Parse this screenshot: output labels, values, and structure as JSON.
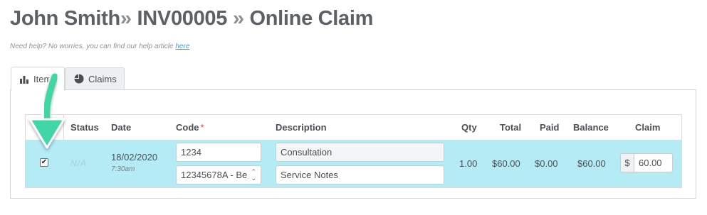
{
  "header": {
    "patient": "John Smith",
    "sep1": "»",
    "invoice": "INV00005",
    "sep2": "»",
    "page": "Online Claim"
  },
  "help": {
    "text": "Need help? No worries, you can find our help article",
    "link": "here"
  },
  "tabs": [
    {
      "label": "Items",
      "icon": "bar-chart-icon",
      "active": true
    },
    {
      "label": "Claims",
      "icon": "pie-chart-icon",
      "active": false
    }
  ],
  "table": {
    "columns": {
      "status": "Status",
      "date": "Date",
      "code": "Code",
      "required_mark": "*",
      "description": "Description",
      "qty": "Qty",
      "total": "Total",
      "paid": "Paid",
      "balance": "Balance",
      "claim": "Claim"
    },
    "row": {
      "checked": true,
      "status": "N/A",
      "date": "18/02/2020",
      "time": "7:30am",
      "code": "1234",
      "code_select": "12345678A - Be",
      "description": "Consultation",
      "notes_placeholder": "Service Notes",
      "qty": "1.00",
      "total": "$60.00",
      "paid": "$0.00",
      "balance": "$60.00",
      "currency": "$",
      "claim": "60.00"
    }
  },
  "colors": {
    "row_highlight": "#b4ebf5",
    "pointer_arrow": "#3fd6a6",
    "required": "#e0433c",
    "link": "#3aa0d8"
  }
}
